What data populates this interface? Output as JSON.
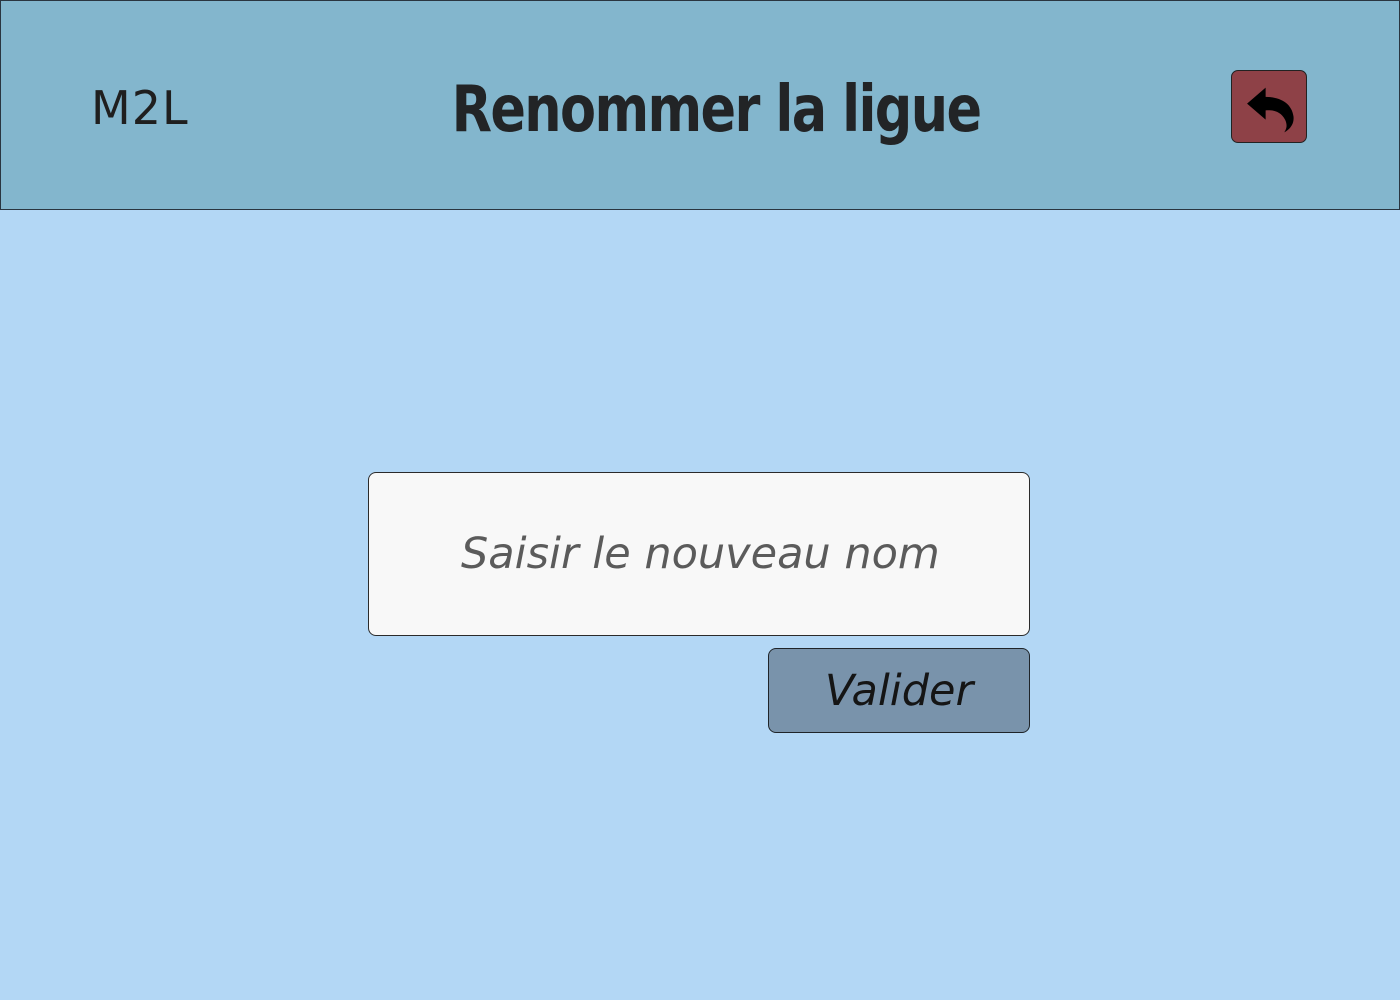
{
  "header": {
    "brand": "M2L",
    "title": "Renommer la ligue",
    "back_icon": "back-arrow-icon"
  },
  "form": {
    "input_placeholder": "Saisir le nouveau nom",
    "input_value": "",
    "submit_label": "Valider"
  },
  "colors": {
    "page_background": "#b3d7f5",
    "header_background": "#83b6cd",
    "back_button": "#8e4147",
    "submit_button": "#7993ab",
    "input_background": "#f8f8f8"
  }
}
